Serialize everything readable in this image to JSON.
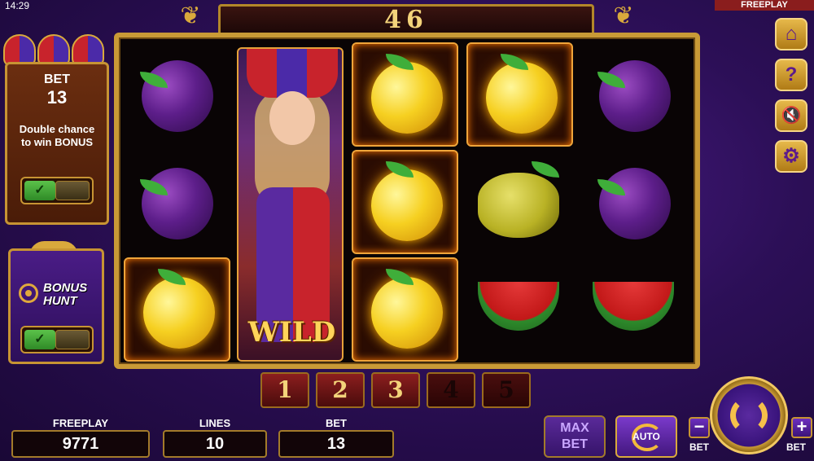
{
  "status": {
    "time": "14:29",
    "mode_tag": "FREEPLAY"
  },
  "win_display": "46",
  "bet_panel": {
    "title": "BET",
    "value": "13",
    "description_line1": "Double chance",
    "description_line2": "to win BONUS",
    "toggle_icon": "✓"
  },
  "bonus_hunt": {
    "title_line1": "BONUS",
    "title_line2": "HUNT",
    "toggle_icon": "✓"
  },
  "reels": [
    {
      "symbols": [
        "plum",
        "plum",
        "orange"
      ],
      "highlight": [
        false,
        false,
        true
      ]
    },
    {
      "symbols": [
        "wild"
      ],
      "highlight": [
        true
      ]
    },
    {
      "symbols": [
        "orange",
        "orange",
        "orange"
      ],
      "highlight": [
        true,
        true,
        true
      ]
    },
    {
      "symbols": [
        "orange",
        "lemon",
        "watermelon"
      ],
      "highlight": [
        true,
        false,
        false
      ]
    },
    {
      "symbols": [
        "plum",
        "plum",
        "watermelon"
      ],
      "highlight": [
        false,
        false,
        false
      ]
    }
  ],
  "wild_label": "WILD",
  "lines_selector": [
    {
      "label": "1",
      "active": true
    },
    {
      "label": "2",
      "active": true
    },
    {
      "label": "3",
      "active": true
    },
    {
      "label": "4",
      "active": false
    },
    {
      "label": "5",
      "active": false
    }
  ],
  "bottom_info": {
    "freeplay_label": "FREEPLAY",
    "freeplay_value": "9771",
    "lines_label": "LINES",
    "lines_value": "10",
    "bet_label": "BET",
    "bet_value": "13"
  },
  "side_buttons": [
    {
      "name": "home-icon",
      "glyph": "⌂"
    },
    {
      "name": "help-icon",
      "glyph": "?"
    },
    {
      "name": "sound-muted-icon",
      "glyph": "🔇"
    },
    {
      "name": "settings-gear-icon",
      "glyph": "⚙"
    }
  ],
  "controls": {
    "max_bet_line1": "MAX",
    "max_bet_line2": "BET",
    "auto_label": "AUTO",
    "minus": "−",
    "plus": "+",
    "minus_label": "BET",
    "plus_label": "BET"
  },
  "colors": {
    "background": "#2c0f57",
    "gold": "#c99a36",
    "win_text": "#f3d37a",
    "toggle_on": "#5bc24a"
  }
}
